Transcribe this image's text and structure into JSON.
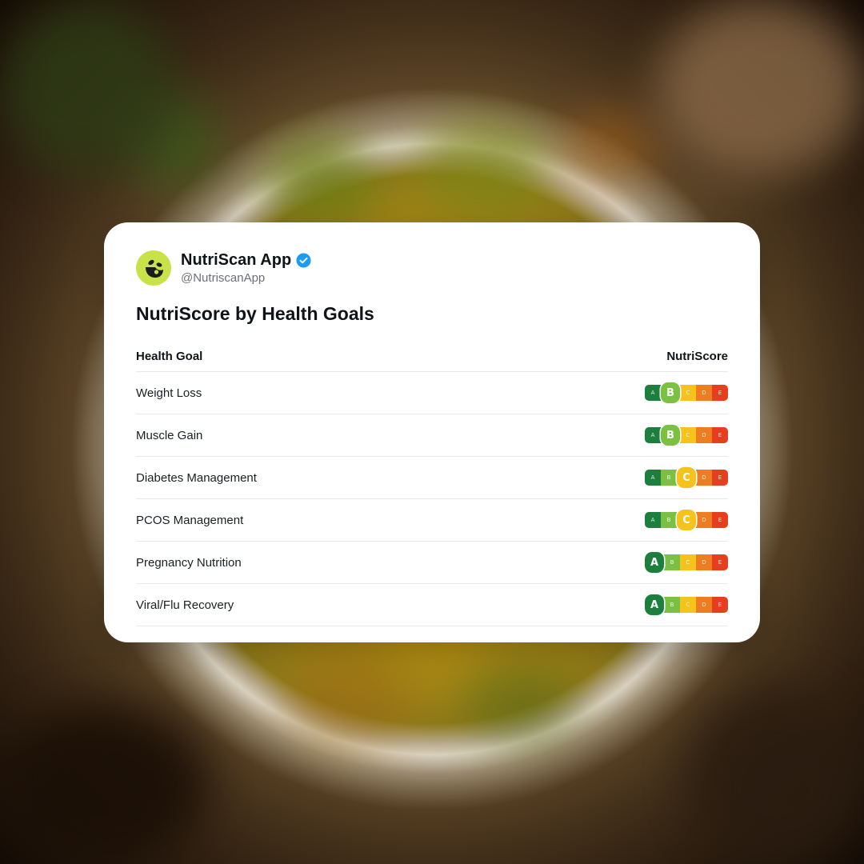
{
  "account": {
    "display_name": "NutriScan App",
    "handle": "@NutriscanApp",
    "avatar_icon": "nutriscan-logo-icon",
    "verified_icon": "verified-badge-icon",
    "avatar_color": "#c8e24a",
    "verified_color": "#1d9bf0"
  },
  "title": "NutriScore by Health Goals",
  "table": {
    "columns": [
      "Health Goal",
      "NutriScore"
    ],
    "rows": [
      {
        "goal": "Weight Loss",
        "score": "B"
      },
      {
        "goal": "Muscle Gain",
        "score": "B"
      },
      {
        "goal": "Diabetes Management",
        "score": "C"
      },
      {
        "goal": "PCOS Management",
        "score": "C"
      },
      {
        "goal": "Pregnancy Nutrition",
        "score": "A"
      },
      {
        "goal": "Viral/Flu Recovery",
        "score": "A"
      }
    ]
  },
  "nutriscore_scale": {
    "grades": [
      "A",
      "B",
      "C",
      "D",
      "E"
    ],
    "colors": [
      "#1d7f3d",
      "#7ac143",
      "#f6c31c",
      "#ee7d21",
      "#e63f1f"
    ]
  }
}
